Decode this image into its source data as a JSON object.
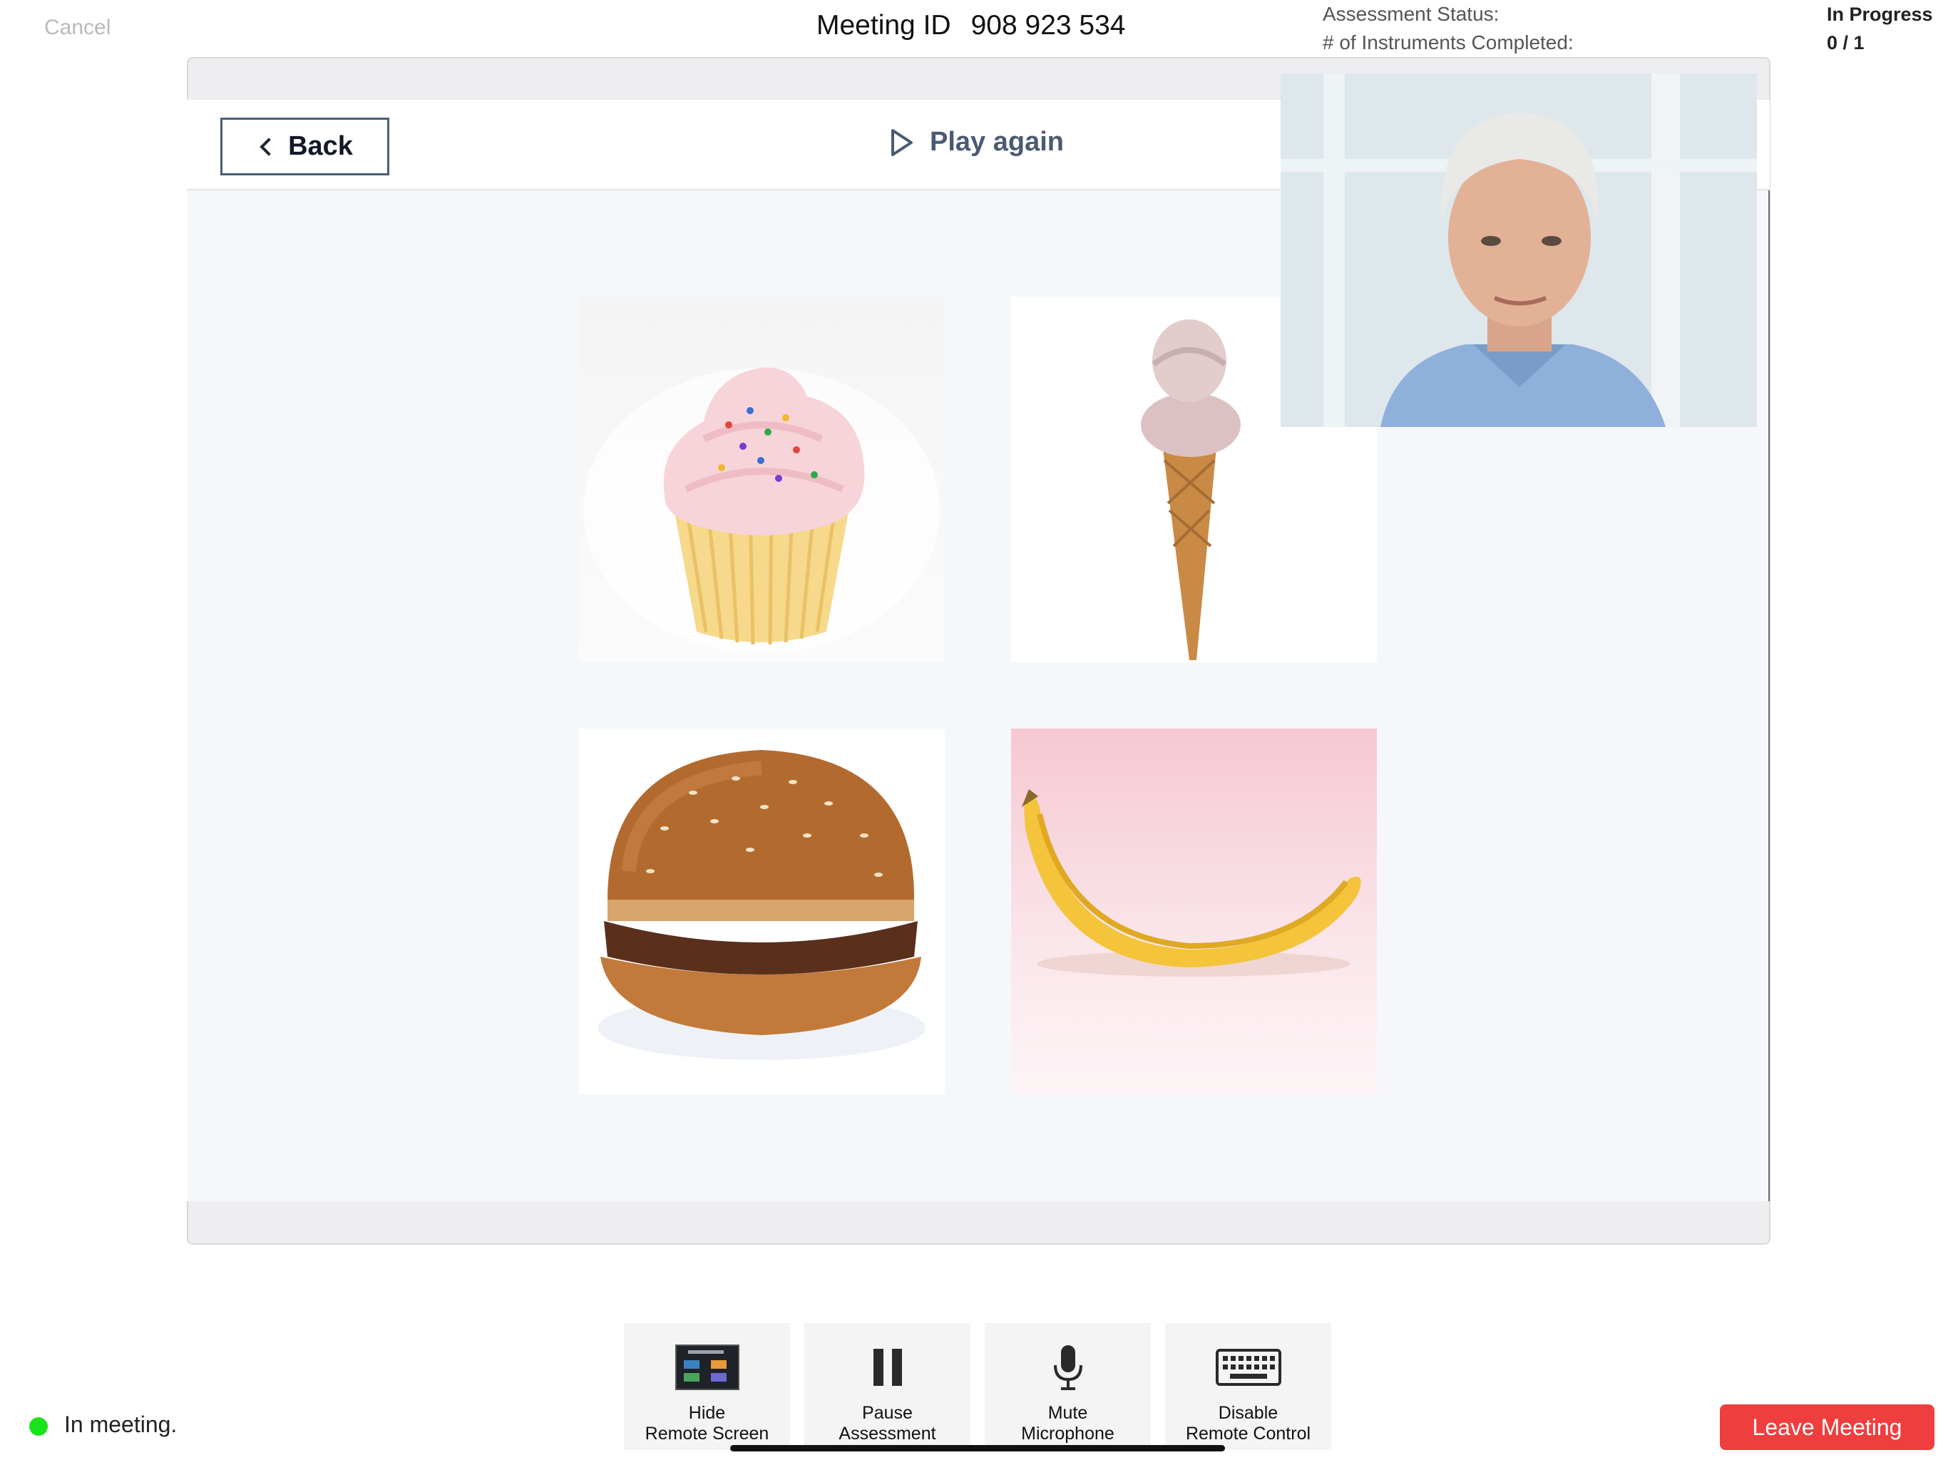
{
  "top_bar": {
    "cancel_label": "Cancel",
    "meeting_id_label": "Meeting ID",
    "meeting_id_value": "908 923 534",
    "assessment_status_label": "Assessment Status:",
    "assessment_status_value": "In Progress",
    "instruments_completed_label": "# of Instruments Completed:",
    "instruments_completed_value": "0 / 1"
  },
  "remote_app": {
    "back_label": "Back",
    "play_again_label": "Play again",
    "choices": [
      {
        "name": "cupcake"
      },
      {
        "name": "ice cream cone"
      },
      {
        "name": "hamburger"
      },
      {
        "name": "banana"
      }
    ]
  },
  "controls": [
    {
      "line1": "Hide",
      "line2": "Remote Screen",
      "icon": "remote-screen-icon"
    },
    {
      "line1": "Pause",
      "line2": "Assessment",
      "icon": "pause-icon"
    },
    {
      "line1": "Mute",
      "line2": "Microphone",
      "icon": "microphone-icon"
    },
    {
      "line1": "Disable",
      "line2": "Remote Control",
      "icon": "keyboard-icon"
    }
  ],
  "footer": {
    "status_text": "In meeting.",
    "leave_label": "Leave Meeting"
  },
  "colors": {
    "status_dot": "#19e419",
    "leave_button": "#ef3e3e",
    "back_border": "#4a5d78"
  }
}
